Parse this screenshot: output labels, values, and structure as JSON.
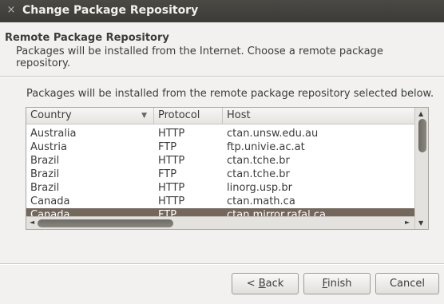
{
  "window": {
    "title": "Change Package Repository",
    "close_glyph": "×"
  },
  "header": {
    "title": "Remote Package Repository",
    "description": "Packages will be installed from the Internet. Choose a remote package repository."
  },
  "intro_text": "Packages will be installed from the remote package repository selected below.",
  "table": {
    "columns": [
      "Country",
      "Protocol",
      "Host"
    ],
    "sort_indicator": "▼",
    "rows": [
      {
        "country": "Australia",
        "protocol": "HTTP",
        "host": "ctan.unsw.edu.au",
        "selected": false
      },
      {
        "country": "Austria",
        "protocol": "FTP",
        "host": "ftp.univie.ac.at",
        "selected": false
      },
      {
        "country": "Brazil",
        "protocol": "HTTP",
        "host": "ctan.tche.br",
        "selected": false
      },
      {
        "country": "Brazil",
        "protocol": "FTP",
        "host": "ctan.tche.br",
        "selected": false
      },
      {
        "country": "Brazil",
        "protocol": "HTTP",
        "host": "linorg.usp.br",
        "selected": false
      },
      {
        "country": "Canada",
        "protocol": "HTTP",
        "host": "ctan.math.ca",
        "selected": false
      },
      {
        "country": "Canada",
        "protocol": "FTP",
        "host": "ctan.mirror.rafal.ca",
        "selected": true
      }
    ],
    "selection_color": "#74675c"
  },
  "buttons": {
    "back": {
      "prefix": "< ",
      "mnemonic": "B",
      "rest": "ack"
    },
    "finish": {
      "mnemonic": "F",
      "rest": "inish"
    },
    "cancel": "Cancel"
  },
  "icons": {
    "scroll_up": "▲",
    "scroll_down": "▼",
    "scroll_left": "◄",
    "scroll_right": "►"
  }
}
